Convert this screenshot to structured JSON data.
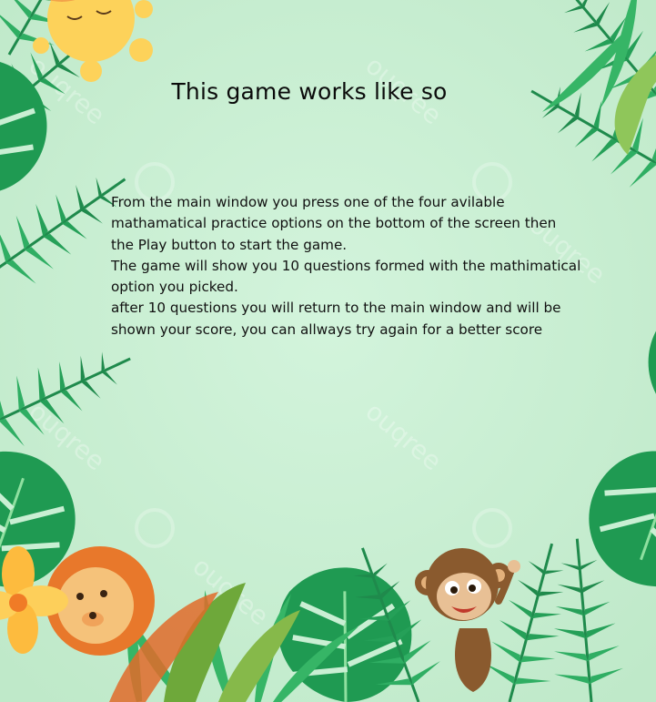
{
  "title": "This game works like so",
  "instructions": {
    "lines": [
      "From the main window you press one of the four avilable",
      "mathamatical practice options on the bottom of the screen then",
      "the Play button to start the game.",
      "The game will show you 10 questions formed with the mathimatical",
      "option you picked.",
      "after 10 questions you will return to the main window and will be",
      "shown your score, you can allways try again for a better score"
    ]
  },
  "colors": {
    "background": "#c9efd3",
    "leaf_dark": "#1f8a4c",
    "leaf_mid": "#2fae63",
    "leaf_light": "#7fd98f",
    "sun": "#fdd25a",
    "lion_mane": "#e8782b",
    "monkey_brown": "#8a5a2e"
  },
  "decor": {
    "sun": "sun-illustration",
    "lion": "lion-illustration",
    "monkey": "monkey-illustration",
    "flower": "flower-illustration",
    "leaves": "jungle-leaves-frame"
  }
}
